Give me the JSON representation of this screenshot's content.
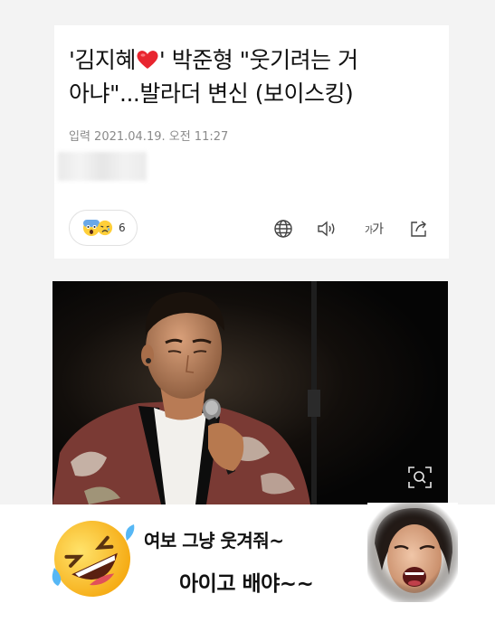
{
  "article": {
    "title_line1_prefix": "'김지혜",
    "title_line1_suffix": "' 박준형 \"웃기려는 거",
    "title_line2": "아냐\"...발라더 변신 (보이스킹)",
    "dateline": "입력 2021.04.19. 오전 11:27",
    "reaction_count": "6",
    "fontsize_label_small": "가",
    "fontsize_label_large": "가"
  },
  "caption": {
    "line1": "여보 그냥 웃겨줘~",
    "line2": "아이고 배야~~"
  },
  "colors": {
    "page_bg": "#f3f3f3",
    "card_bg": "#ffffff",
    "heart": "#e8252f",
    "photo_bg": "#050505"
  },
  "icons": [
    "red-heart-emoji-icon",
    "scared-face-icon",
    "sad-face-icon",
    "globe-icon",
    "speaker-icon",
    "font-size-icon",
    "share-icon",
    "zoom-search-icon",
    "rolling-laughing-emoji-icon"
  ]
}
